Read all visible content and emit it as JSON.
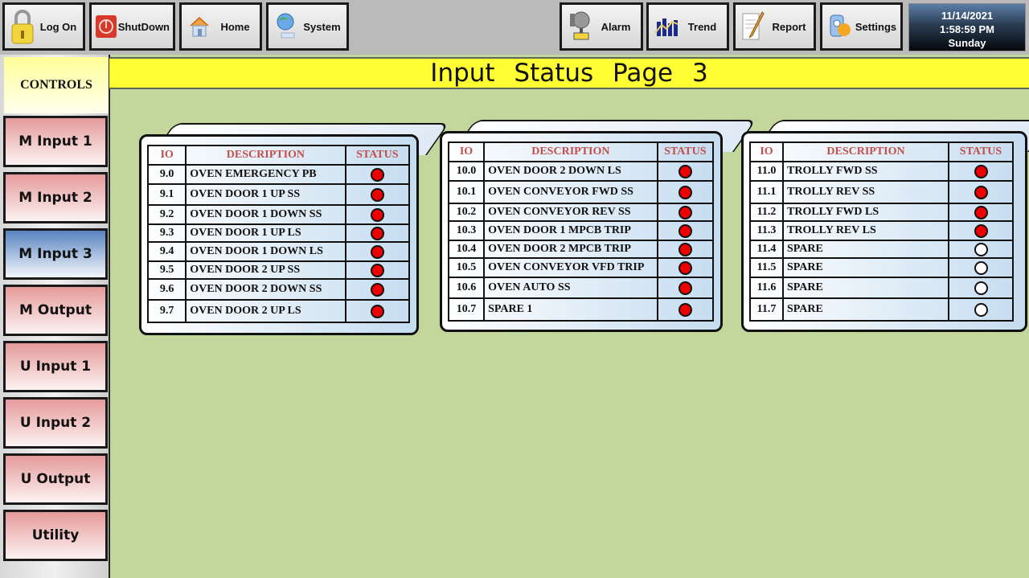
{
  "toolbar": {
    "buttons": [
      {
        "label": "Log On",
        "icon": "lock-icon"
      },
      {
        "label": "ShutDown",
        "icon": "power-icon"
      },
      {
        "label": "Home",
        "icon": "home-icon"
      },
      {
        "label": "System",
        "icon": "globe-network-icon"
      },
      {
        "label": "Alarm",
        "icon": "bell-icon"
      },
      {
        "label": "Trend",
        "icon": "trend-chart-icon"
      },
      {
        "label": "Report",
        "icon": "report-pencil-icon"
      },
      {
        "label": "Settings",
        "icon": "settings-icon"
      }
    ],
    "clock": {
      "date": "11/14/2021",
      "time": "1:58:59 PM",
      "day": "Sunday"
    }
  },
  "title": "Input Status Page 3",
  "sidebar": {
    "header": "CONTROLS",
    "items": [
      {
        "label": "M Input 1",
        "active": false
      },
      {
        "label": "M Input 2",
        "active": false
      },
      {
        "label": "M Input 3",
        "active": true
      },
      {
        "label": "M Output",
        "active": false
      },
      {
        "label": "U Input 1",
        "active": false
      },
      {
        "label": "U Input 2",
        "active": false
      },
      {
        "label": "U Output",
        "active": false
      },
      {
        "label": "Utility",
        "active": false
      }
    ]
  },
  "colors": {
    "lamp_on": "#ee0000",
    "lamp_off": "#ffffff",
    "header_text": "#c0504d",
    "title_bg": "#ffff33",
    "background": "#c3d69b"
  },
  "columns": {
    "io": "IO",
    "description": "DESCRIPTION",
    "status": "STATUS"
  },
  "panels": [
    {
      "rows": [
        {
          "io": "9.0",
          "desc": "OVEN EMERGENCY PB",
          "on": true
        },
        {
          "io": "9.1",
          "desc": "OVEN DOOR 1 UP SS",
          "on": true
        },
        {
          "io": "9.2",
          "desc": "OVEN DOOR 1 DOWN SS",
          "on": true
        },
        {
          "io": "9.3",
          "desc": "OVEN DOOR 1 UP LS",
          "on": true
        },
        {
          "io": "9.4",
          "desc": "OVEN DOOR 1 DOWN LS",
          "on": true
        },
        {
          "io": "9.5",
          "desc": "OVEN DOOR 2 UP SS",
          "on": true
        },
        {
          "io": "9.6",
          "desc": "OVEN DOOR 2 DOWN SS",
          "on": true
        },
        {
          "io": "9.7",
          "desc": "OVEN DOOR 2 UP LS",
          "on": true
        }
      ]
    },
    {
      "rows": [
        {
          "io": "10.0",
          "desc": "OVEN DOOR 2 DOWN LS",
          "on": true
        },
        {
          "io": "10.1",
          "desc": "OVEN CONVEYOR FWD SS",
          "on": true
        },
        {
          "io": "10.2",
          "desc": "OVEN CONVEYOR REV SS",
          "on": true
        },
        {
          "io": "10.3",
          "desc": "OVEN DOOR 1 MPCB TRIP",
          "on": true
        },
        {
          "io": "10.4",
          "desc": "OVEN DOOR 2 MPCB TRIP",
          "on": true
        },
        {
          "io": "10.5",
          "desc": "OVEN CONVEYOR VFD TRIP",
          "on": true
        },
        {
          "io": "10.6",
          "desc": "OVEN AUTO SS",
          "on": true
        },
        {
          "io": "10.7",
          "desc": "SPARE 1",
          "on": true
        }
      ]
    },
    {
      "rows": [
        {
          "io": "11.0",
          "desc": "TROLLY FWD SS",
          "on": true
        },
        {
          "io": "11.1",
          "desc": "TROLLY REV SS",
          "on": true
        },
        {
          "io": "11.2",
          "desc": "TROLLY FWD LS",
          "on": true
        },
        {
          "io": "11.3",
          "desc": "TROLLY REV LS",
          "on": true
        },
        {
          "io": "11.4",
          "desc": "SPARE",
          "on": false
        },
        {
          "io": "11.5",
          "desc": "SPARE",
          "on": false
        },
        {
          "io": "11.6",
          "desc": "SPARE",
          "on": false
        },
        {
          "io": "11.7",
          "desc": "SPARE",
          "on": false
        }
      ]
    }
  ]
}
